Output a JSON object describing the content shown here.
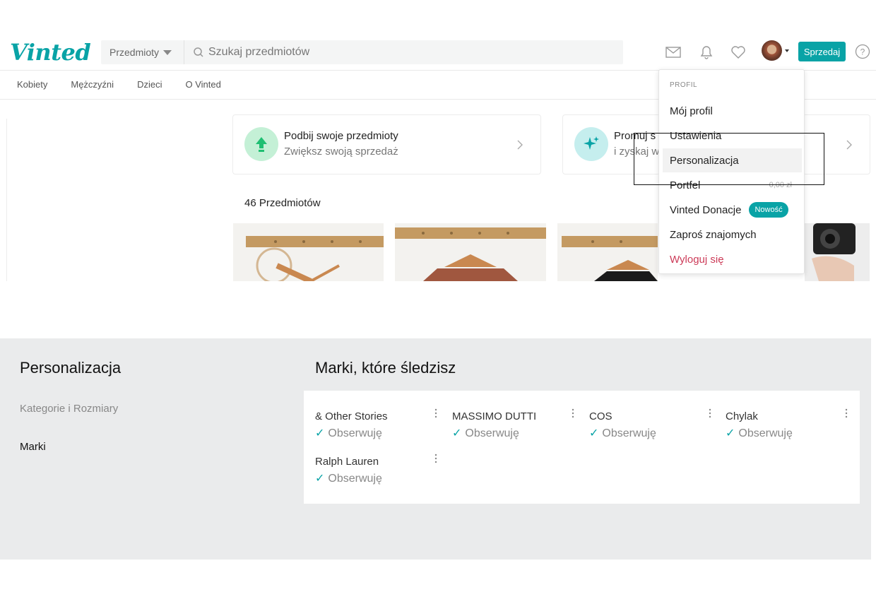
{
  "header": {
    "logo": "Vinted",
    "category_select": "Przedmioty",
    "search_placeholder": "Szukaj przedmiotów",
    "sell_label": "Sprzedaj",
    "icons": [
      "mail-icon",
      "bell-icon",
      "heart-icon",
      "help-icon"
    ]
  },
  "nav": {
    "items": [
      {
        "label": "Kobiety"
      },
      {
        "label": "Mężczyźni"
      },
      {
        "label": "Dzieci"
      },
      {
        "label": "O Vinted"
      }
    ]
  },
  "promos": [
    {
      "title": "Podbij swoje przedmioty",
      "subtitle": "Zwiększ swoją sprzedaż"
    },
    {
      "title": "Promuj s",
      "subtitle": "i zyskaj w"
    }
  ],
  "items_count": "46 Przedmiotów",
  "dropdown": {
    "section": "PROFIL",
    "items": [
      {
        "label": "Mój profil"
      },
      {
        "label": "Ustawienia"
      },
      {
        "label": "Personalizacja"
      },
      {
        "label": "Portfel",
        "value": "0,00 zł"
      },
      {
        "label": "Vinted Donacje",
        "badge": "Nowość"
      },
      {
        "label": "Zaproś znajomych"
      },
      {
        "label": "Wyloguj się"
      }
    ]
  },
  "personalization": {
    "title": "Personalizacja",
    "side_links": [
      {
        "label": "Kategorie i Rozmiary"
      },
      {
        "label": "Marki"
      }
    ],
    "brands_title": "Marki, które śledzisz",
    "follow_label": "Obserwuję",
    "brands": [
      {
        "name": "& Other Stories"
      },
      {
        "name": "MASSIMO DUTTI"
      },
      {
        "name": "COS"
      },
      {
        "name": "Chylak"
      },
      {
        "name": "Ralph Lauren"
      }
    ]
  },
  "colors": {
    "accent": "#09a3a6",
    "logout": "#cc3b58",
    "panel_bg": "#eaebec"
  }
}
